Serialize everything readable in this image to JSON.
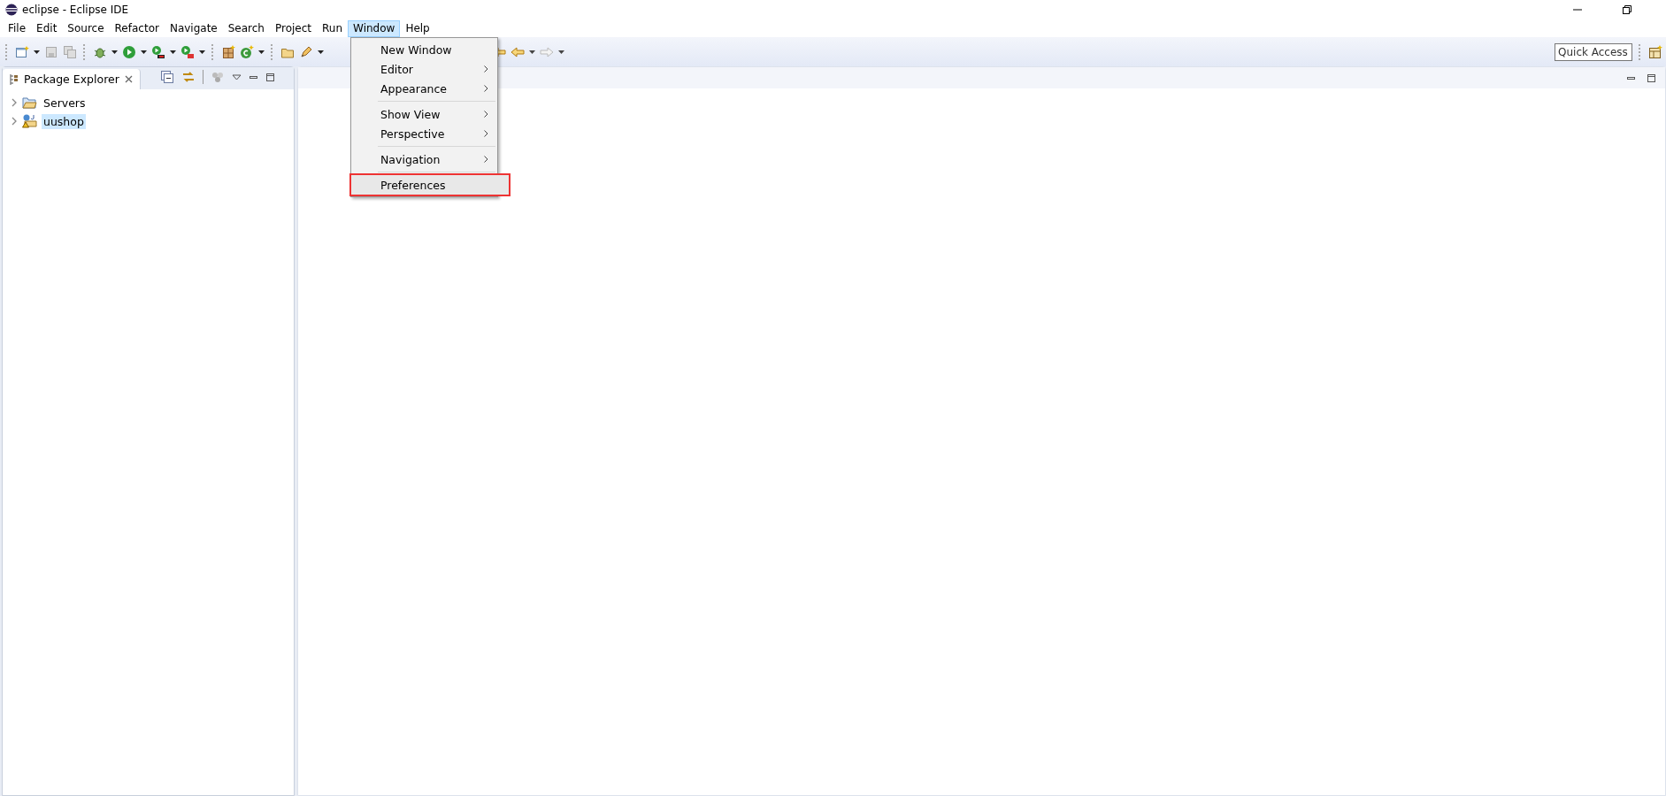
{
  "window": {
    "title": "eclipse - Eclipse IDE"
  },
  "menu_bar": [
    {
      "label": "File",
      "selected": false
    },
    {
      "label": "Edit",
      "selected": false
    },
    {
      "label": "Source",
      "selected": false
    },
    {
      "label": "Refactor",
      "selected": false
    },
    {
      "label": "Navigate",
      "selected": false
    },
    {
      "label": "Search",
      "selected": false
    },
    {
      "label": "Project",
      "selected": false
    },
    {
      "label": "Run",
      "selected": false
    },
    {
      "label": "Window",
      "selected": true
    },
    {
      "label": "Help",
      "selected": false
    }
  ],
  "quick_access": {
    "placeholder": "Quick Access"
  },
  "package_explorer": {
    "title": "Package Explorer",
    "items": [
      {
        "label": "Servers",
        "kind": "folder",
        "selected": false,
        "expanded": false
      },
      {
        "label": "uushop",
        "kind": "project",
        "selected": true,
        "expanded": false
      }
    ]
  },
  "window_menu": {
    "groups": [
      [
        {
          "label": "New Window",
          "submenu": false,
          "highlighted": false
        },
        {
          "label": "Editor",
          "submenu": true,
          "highlighted": false
        },
        {
          "label": "Appearance",
          "submenu": true,
          "highlighted": false
        }
      ],
      [
        {
          "label": "Show View",
          "submenu": true,
          "highlighted": false
        },
        {
          "label": "Perspective",
          "submenu": true,
          "highlighted": false
        }
      ],
      [
        {
          "label": "Navigation",
          "submenu": true,
          "highlighted": false
        }
      ],
      [
        {
          "label": "Preferences",
          "submenu": false,
          "highlighted": true
        }
      ]
    ]
  }
}
